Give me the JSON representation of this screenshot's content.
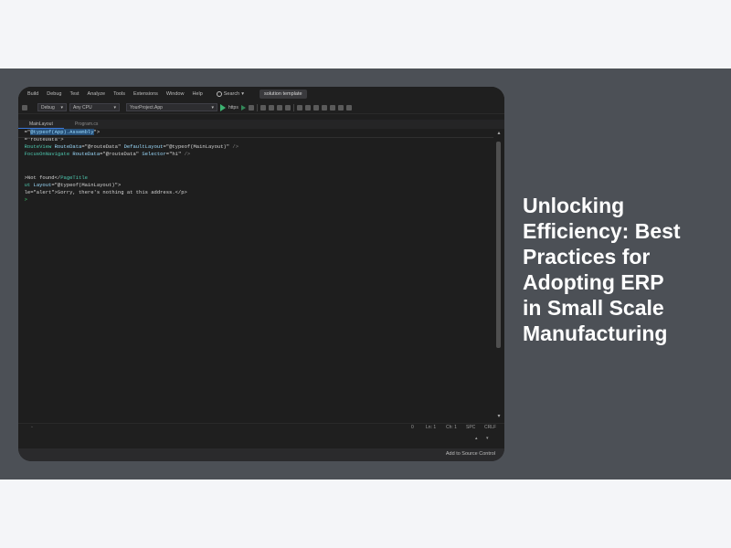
{
  "menu": [
    "Build",
    "Debug",
    "Test",
    "Analyze",
    "Tools",
    "Extensions",
    "Window",
    "Help"
  ],
  "search": {
    "label": "Search",
    "chevron": "▾"
  },
  "solution_tag": "solution template",
  "toolbar": {
    "config": "Debug",
    "platform": "Any CPU",
    "project": "YourProject.App",
    "run_label": "https",
    "dropdown_glyph": "▾"
  },
  "tabs": [
    "MainLayout",
    "Program.cs"
  ],
  "code": {
    "l1": {
      "a": "  =\"",
      "b": "@typeof(App).Assembly",
      "c": "\">"
    },
    "l2": {
      "a": "  =\"routeData\">"
    },
    "l3": {
      "a": "  ",
      "b": "RouteView",
      "c": " RouteData",
      "d": "=\"@routeData\"",
      "e": " DefaultLayout",
      "f": "=\"@typeof(MainLayout)\"",
      "g": " />"
    },
    "l4": {
      "a": "  ",
      "b": "FocusOnNavigate",
      "c": " RouteData",
      "d": "=\"@routeData\"",
      "e": " Selector",
      "f": "=\"h1\"",
      "g": " />"
    },
    "l5": {
      "a": "  >Not found</",
      "b": "PageTitle"
    },
    "l6": {
      "a": "  ",
      "b": "ut",
      "c": " Layout",
      "d": "=\"@typeof(MainLayout)\">"
    },
    "l7": {
      "a": "  le=\"alert\">Sorry, there's nothing at this address.</p>"
    },
    "l8": {
      "a": "  >"
    }
  },
  "status": {
    "issues": "0",
    "line": "Ln: 1",
    "col": "Ch: 1",
    "enc": "SPC",
    "eol": "CRLF"
  },
  "git": {
    "label": "Add to Source Control"
  },
  "headline": [
    "Unlocking",
    "Efficiency: Best",
    "Practices for",
    "Adopting ERP",
    "in Small Scale",
    "Manufacturing"
  ]
}
